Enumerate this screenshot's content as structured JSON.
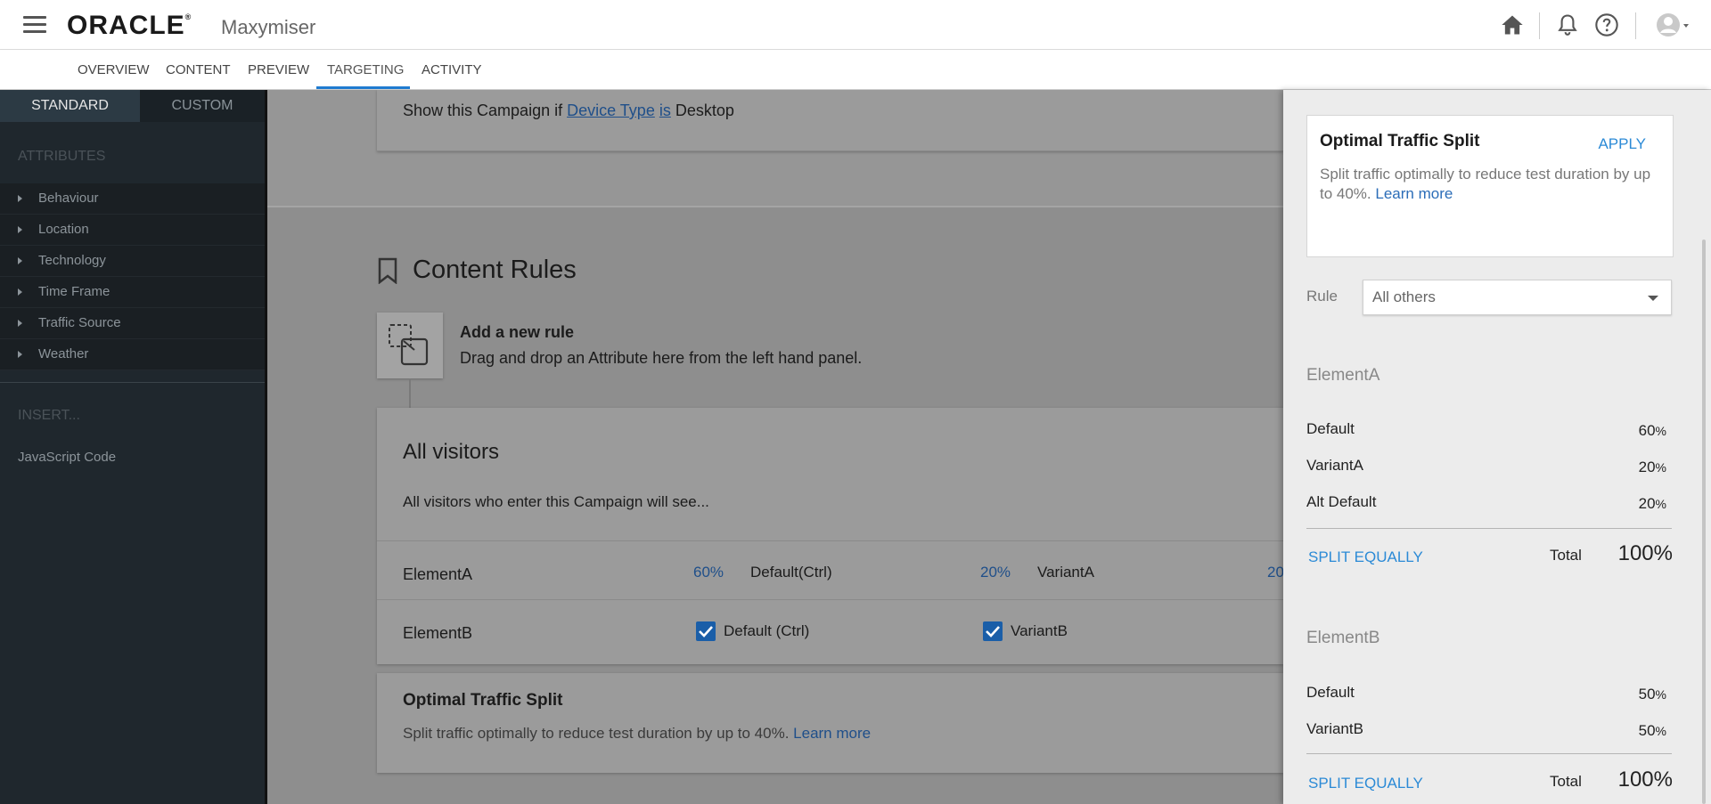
{
  "header": {
    "logo": "ORACLE",
    "logo_mark": "®",
    "product": "Maxymiser"
  },
  "nav": {
    "tabs": [
      "OVERVIEW",
      "CONTENT",
      "PREVIEW",
      "TARGETING",
      "ACTIVITY"
    ],
    "active": "TARGETING",
    "accent": "#1f7bd0"
  },
  "sidebar": {
    "tabs": [
      "STANDARD",
      "CUSTOM"
    ],
    "attributes_heading": "ATTRIBUTES",
    "attributes": [
      "Behaviour",
      "Location",
      "Technology",
      "Time Frame",
      "Traffic Source",
      "Weather"
    ],
    "insert_heading": "INSERT...",
    "insert_items": [
      "JavaScript Code"
    ]
  },
  "main": {
    "show_rule": {
      "prefix": "Show this Campaign if",
      "attribute": "Device Type",
      "operator": "is",
      "value": "Desktop"
    },
    "content_rules_title": "Content Rules",
    "add_rule": {
      "title": "Add a new rule",
      "desc": "Drag and drop an Attribute here from the left hand panel."
    },
    "all_visitors": {
      "title": "All visitors",
      "desc": "All visitors who enter this Campaign will see...",
      "elementA": {
        "label": "ElementA",
        "variants": [
          {
            "pct": "60%",
            "name": "Default(Ctrl)"
          },
          {
            "pct": "20%",
            "name": "VariantA"
          },
          {
            "pct": "20",
            "name": ""
          }
        ]
      },
      "elementB": {
        "label": "ElementB",
        "variants": [
          {
            "name": "Default (Ctrl)",
            "checked": true
          },
          {
            "name": "VariantB",
            "checked": true
          }
        ]
      }
    },
    "ots": {
      "title": "Optimal Traffic Split",
      "desc": "Split traffic optimally to reduce test duration by up to 40%.",
      "link": "Learn more"
    }
  },
  "panel": {
    "ots": {
      "title": "Optimal Traffic Split",
      "apply": "APPLY",
      "desc": "Split traffic optimally to reduce test duration by up to 40%.",
      "link": "Learn more"
    },
    "rule_label": "Rule",
    "rule_value": "All others",
    "elementA": {
      "title": "ElementA",
      "rows": [
        {
          "name": "Default",
          "pct": "60",
          "unit": "%"
        },
        {
          "name": "VariantA",
          "pct": "20",
          "unit": "%"
        },
        {
          "name": "Alt Default",
          "pct": "20",
          "unit": "%"
        }
      ],
      "split_label": "SPLIT EQUALLY",
      "total_label": "Total",
      "total": "100%"
    },
    "elementB": {
      "title": "ElementB",
      "rows": [
        {
          "name": "Default",
          "pct": "50",
          "unit": "%"
        },
        {
          "name": "VariantB",
          "pct": "50",
          "unit": "%"
        }
      ],
      "split_label": "SPLIT EQUALLY",
      "total_label": "Total",
      "total": "100%"
    }
  }
}
